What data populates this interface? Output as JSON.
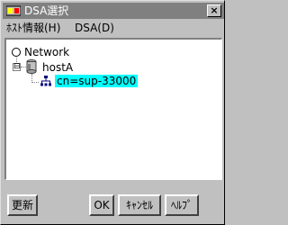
{
  "window": {
    "title": "DSA選択",
    "close_glyph": "×"
  },
  "menu": {
    "items": [
      {
        "label": "ﾎｽﾄ情報(H)"
      },
      {
        "label": "DSA(D)"
      }
    ]
  },
  "tree": {
    "root": {
      "label": "Network",
      "icon": "radio-icon"
    },
    "host": {
      "label": "hostA",
      "icon": "server-icon",
      "expander": "⊟"
    },
    "dsa": {
      "label": "cn=sup-33000",
      "icon": "directory-icon",
      "selected": true
    }
  },
  "buttons": {
    "update": "更新",
    "ok": "OK",
    "cancel": "ｷｬﾝｾﾙ",
    "help": "ﾍﾙﾌﾟ"
  },
  "colors": {
    "selection": "#00ffff",
    "titlebar": "#808080",
    "face": "#c0c0c0"
  }
}
